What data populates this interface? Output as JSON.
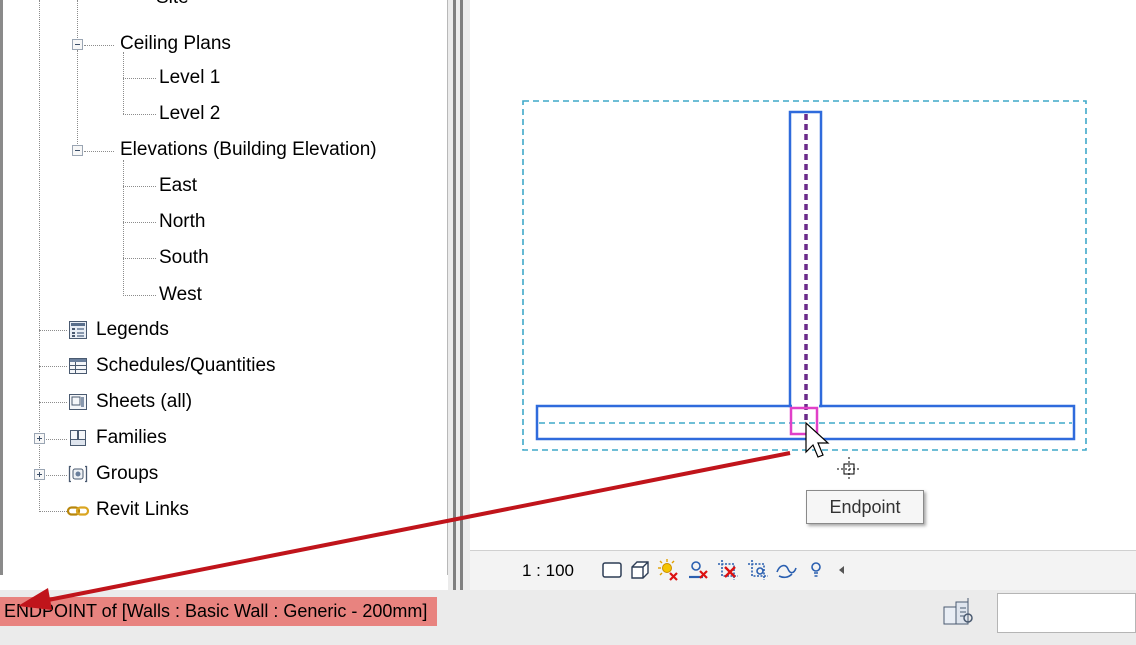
{
  "project_browser": {
    "partial_item": "Site",
    "items": [
      {
        "label": "Ceiling Plans",
        "icon": null
      },
      {
        "label": "Level 1",
        "icon": null
      },
      {
        "label": "Level 2",
        "icon": null
      },
      {
        "label": "Elevations (Building Elevation)",
        "icon": null
      },
      {
        "label": "East",
        "icon": null
      },
      {
        "label": "North",
        "icon": null
      },
      {
        "label": "South",
        "icon": null
      },
      {
        "label": "West",
        "icon": null
      },
      {
        "label": "Legends",
        "icon": "legend-icon"
      },
      {
        "label": "Schedules/Quantities",
        "icon": "schedule-icon"
      },
      {
        "label": "Sheets (all)",
        "icon": "sheet-icon"
      },
      {
        "label": "Families",
        "icon": "families-icon"
      },
      {
        "label": "Groups",
        "icon": "groups-icon"
      },
      {
        "label": "Revit Links",
        "icon": "revit-links-icon"
      }
    ]
  },
  "view_control_bar": {
    "scale": "1 : 100",
    "icons": [
      "detail-level-icon",
      "visual-style-icon",
      "sun-path-icon",
      "shadows-icon",
      "crop-view-icon",
      "show-crop-region-icon",
      "temporary-hide-icon",
      "reveal-hidden-icon",
      "scroll-left-icon"
    ]
  },
  "tooltip": {
    "text": "Endpoint"
  },
  "status_bar": {
    "text": "ENDPOINT  of [Walls : Basic Wall : Generic - 200mm]",
    "worksharing_icon": "worksets-icon"
  },
  "colors": {
    "wall_outline": "#2f6bdc",
    "dashed_bounds": "#3fa9c9",
    "centerline": "#6a2a8a",
    "snap_box": "#e040c8",
    "callout_arrow": "#c0141b",
    "status_highlight": "#e8837f"
  }
}
